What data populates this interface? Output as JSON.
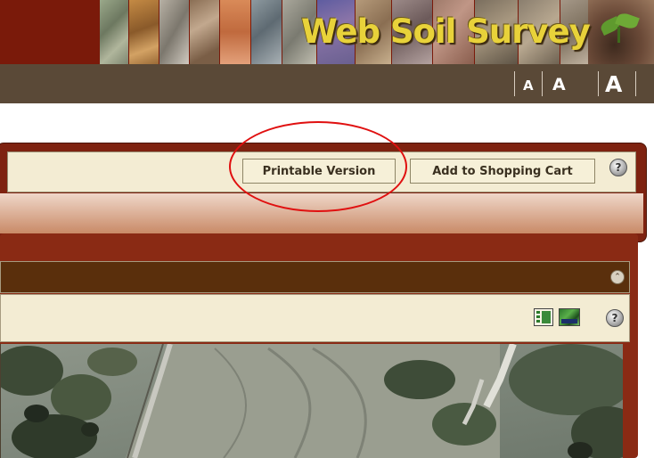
{
  "header": {
    "title": "Web Soil Survey",
    "font_size_options": [
      "A",
      "A",
      "A"
    ]
  },
  "toolbar": {
    "printable_label": "Printable Version",
    "cart_label": "Add to Shopping Cart",
    "help_glyph": "?"
  },
  "map_panel": {
    "collapse_glyph": "⌃",
    "help_glyph": "?"
  },
  "colors": {
    "brand_red": "#7a1a0a",
    "toolbar_brown": "#5a4937",
    "title_yellow": "#e8d23a",
    "annotation_red": "#e01010"
  }
}
